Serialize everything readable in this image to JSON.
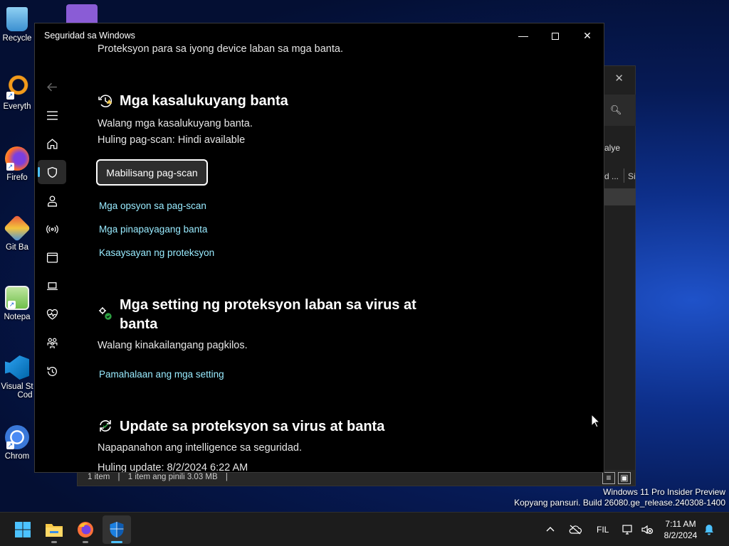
{
  "desktop": {
    "icons": [
      {
        "label": "Recycle",
        "name": "recycle-bin"
      },
      {
        "label": "Everyth",
        "name": "everything"
      },
      {
        "label": "Firefo",
        "name": "firefox"
      },
      {
        "label": "Git Ba",
        "name": "git-bash"
      },
      {
        "label": "Notepa",
        "name": "notepad"
      },
      {
        "label": "Visual St",
        "label2": "Cod",
        "name": "vscode"
      },
      {
        "label": "Chrom",
        "name": "chrome"
      }
    ]
  },
  "background_window": {
    "close_glyph": "✕",
    "view_label": "alye",
    "col1": "d ...",
    "col2": "Si",
    "status_items": "1 item",
    "status_selected": "1 item ang pinili  3.03 MB",
    "sep": "|"
  },
  "security_window": {
    "title": "Seguridad sa Windows",
    "controls": {
      "minimize": "—",
      "close": "✕"
    },
    "subtitle": "Proteksyon para sa iyong device laban sa mga banta.",
    "current_threats": {
      "title": "Mga kasalukuyang banta",
      "status": "Walang mga kasalukuyang banta.",
      "last_scan": "Huling pag-scan: Hindi available",
      "scan_button": "Mabilisang pag-scan",
      "links": [
        "Mga opsyon sa pag-scan",
        "Mga pinapayagang banta",
        "Kasaysayan ng proteksyon"
      ]
    },
    "settings": {
      "title_line1": "Mga setting ng proteksyon laban sa virus at",
      "title_line2": "banta",
      "status": "Walang kinakailangang pagkilos.",
      "link": "Pamahalaan ang mga setting"
    },
    "updates": {
      "title": "Update sa proteksyon sa virus at banta",
      "status": "Napapanahon ang intelligence sa seguridad.",
      "last_update": "Huling update: 8/2/2024 6:22 AM"
    }
  },
  "watermark": {
    "line1": "Windows 11 Pro Insider Preview",
    "line2": "Kopyang pansuri. Build 26080.ge_release.240308-1400"
  },
  "taskbar": {
    "language": "FIL",
    "time": "7:11 AM",
    "date": "8/2/2024"
  },
  "colors": {
    "accent": "#4cc2ff",
    "link": "#99ebff",
    "window_bg": "#000000"
  }
}
